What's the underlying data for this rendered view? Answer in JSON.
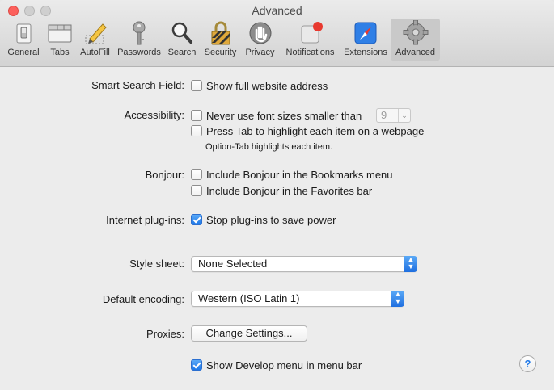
{
  "window": {
    "title": "Advanced"
  },
  "toolbar": {
    "items": [
      {
        "label": "General",
        "icon": "general-switch-icon"
      },
      {
        "label": "Tabs",
        "icon": "tabs-icon"
      },
      {
        "label": "AutoFill",
        "icon": "autofill-pencil-icon"
      },
      {
        "label": "Passwords",
        "icon": "key-icon"
      },
      {
        "label": "Search",
        "icon": "magnifier-icon"
      },
      {
        "label": "Security",
        "icon": "lock-icon"
      },
      {
        "label": "Privacy",
        "icon": "hand-icon"
      },
      {
        "label": "Notifications",
        "icon": "notification-badge-icon"
      },
      {
        "label": "Extensions",
        "icon": "compass-icon"
      },
      {
        "label": "Advanced",
        "icon": "gear-icon",
        "active": true
      }
    ]
  },
  "settings": {
    "smart_search": {
      "label": "Smart Search Field:",
      "option": "Show full website address",
      "checked": false
    },
    "accessibility": {
      "label": "Accessibility:",
      "font_option": "Never use font sizes smaller than",
      "font_size_value": "9",
      "tab_option": "Press Tab to highlight each item on a webpage",
      "tab_hint": "Option-Tab highlights each item."
    },
    "bonjour": {
      "label": "Bonjour:",
      "bookmarks_option": "Include Bonjour in the Bookmarks menu",
      "favorites_option": "Include Bonjour in the Favorites bar"
    },
    "plugins": {
      "label": "Internet plug-ins:",
      "option": "Stop plug-ins to save power",
      "checked": true
    },
    "stylesheet": {
      "label": "Style sheet:",
      "value": "None Selected"
    },
    "encoding": {
      "label": "Default encoding:",
      "value": "Western (ISO Latin 1)"
    },
    "proxies": {
      "label": "Proxies:",
      "button": "Change Settings..."
    },
    "develop": {
      "option": "Show Develop menu in menu bar",
      "checked": true
    },
    "help": "?"
  },
  "colors": {
    "accent": "#1e78e8",
    "close": "#fc605c",
    "notification_badge": "#e8392f"
  }
}
